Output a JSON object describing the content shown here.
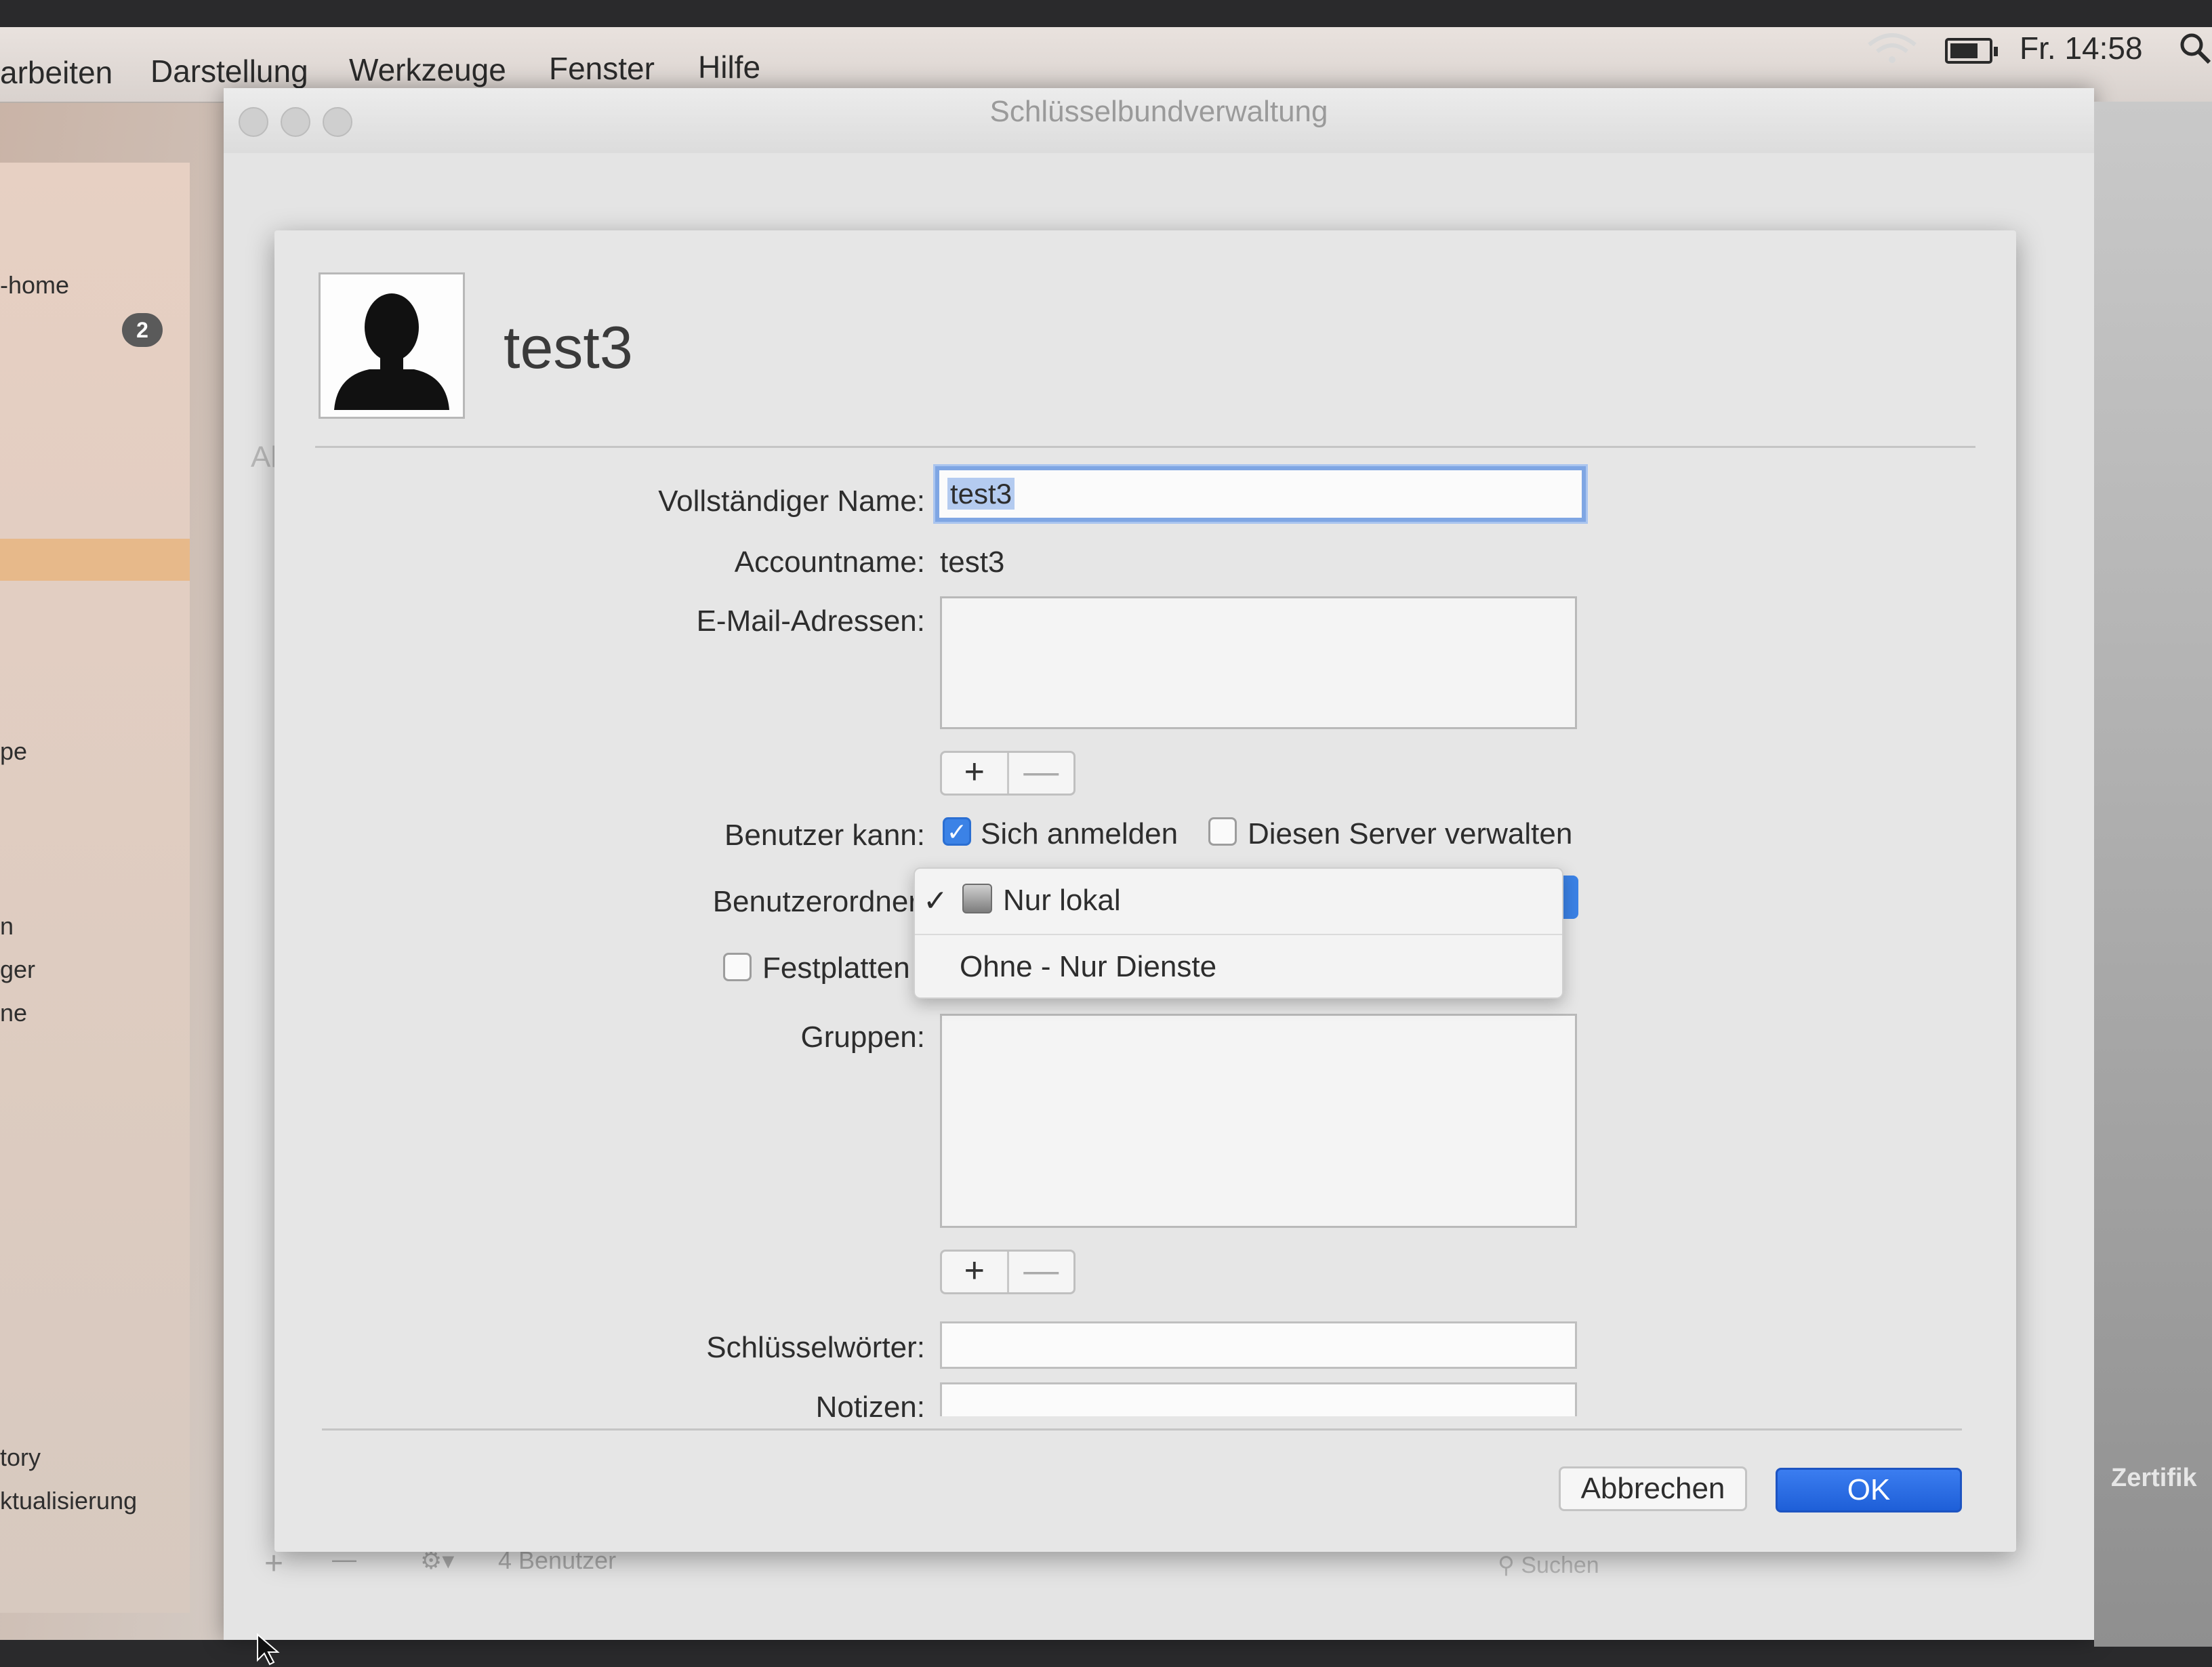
{
  "menubar": {
    "items": [
      "arbeiten",
      "Darstellung",
      "Werkzeuge",
      "Fenster",
      "Hilfe"
    ],
    "clock": "Fr. 14:58"
  },
  "background_window": {
    "title": "Schlüsselbundverwaltung",
    "sidebar": {
      "item_home": "-home",
      "badge": "2",
      "item_pe": "pe",
      "item_n": "n",
      "item_ger": "ger",
      "item_ne": "ne",
      "item_tory": "tory",
      "item_update": "ktualisierung",
      "column_fragment": "Al"
    },
    "footer": {
      "add": "+",
      "remove": "—",
      "user_count": "4 Benutzer",
      "search_placeholder": "Suchen"
    },
    "right_panel_label": "Zertifik"
  },
  "sheet": {
    "user_name_heading": "test3",
    "full_name_label": "Vollständiger Name:",
    "full_name_value": "test3",
    "account_label": "Accountname:",
    "account_value": "test3",
    "email_label": "E-Mail-Adressen:",
    "add_symbol": "+",
    "remove_symbol": "—",
    "user_can_label": "Benutzer kann:",
    "login_label": "Sich anmelden",
    "login_checked": true,
    "admin_label": "Diesen Server verwalten",
    "admin_checked": false,
    "home_folder_label": "Benutzerordner",
    "home_folder_options": [
      "Nur lokal",
      "Ohne - Nur Dienste"
    ],
    "home_folder_selected": "Nur lokal",
    "check_mark": "✓",
    "disk_quota_label": "Festplatten",
    "groups_label": "Gruppen:",
    "keywords_label": "Schlüsselwörter:",
    "notes_label": "Notizen:",
    "cancel_button": "Abbrechen",
    "ok_button": "OK",
    "accent_color": "#3b82e6"
  }
}
